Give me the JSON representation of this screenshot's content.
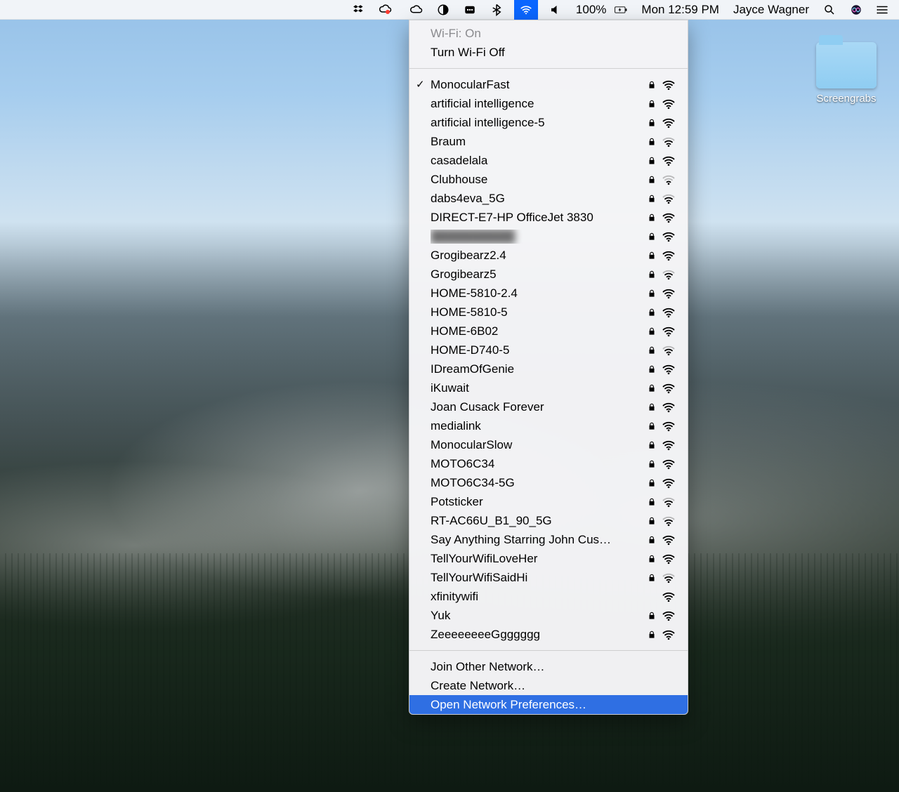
{
  "menubar": {
    "battery_text": "100%",
    "datetime": "Mon 12:59 PM",
    "username": "Jayce Wagner"
  },
  "desktop": {
    "folder_label": "Screengrabs"
  },
  "wifi_menu": {
    "status_label": "Wi-Fi: On",
    "toggle_label": "Turn Wi-Fi Off",
    "join_other_label": "Join Other Network…",
    "create_label": "Create Network…",
    "open_prefs_label": "Open Network Preferences…",
    "networks": [
      {
        "name": "MonocularFast",
        "locked": true,
        "signal": "full",
        "checked": true,
        "blurred": false
      },
      {
        "name": "artificial intelligence",
        "locked": true,
        "signal": "full",
        "checked": false,
        "blurred": false
      },
      {
        "name": "artificial intelligence-5",
        "locked": true,
        "signal": "full",
        "checked": false,
        "blurred": false
      },
      {
        "name": "Braum",
        "locked": true,
        "signal": "mid",
        "checked": false,
        "blurred": false
      },
      {
        "name": "casadelala",
        "locked": true,
        "signal": "full",
        "checked": false,
        "blurred": false
      },
      {
        "name": "Clubhouse",
        "locked": true,
        "signal": "low",
        "checked": false,
        "blurred": false
      },
      {
        "name": "dabs4eva_5G",
        "locked": true,
        "signal": "mid",
        "checked": false,
        "blurred": false
      },
      {
        "name": "DIRECT-E7-HP OfficeJet 3830",
        "locked": true,
        "signal": "full",
        "checked": false,
        "blurred": false
      },
      {
        "name": "██████████",
        "locked": true,
        "signal": "full",
        "checked": false,
        "blurred": true
      },
      {
        "name": "Grogibearz2.4",
        "locked": true,
        "signal": "full",
        "checked": false,
        "blurred": false
      },
      {
        "name": "Grogibearz5",
        "locked": true,
        "signal": "mid",
        "checked": false,
        "blurred": false
      },
      {
        "name": "HOME-5810-2.4",
        "locked": true,
        "signal": "full",
        "checked": false,
        "blurred": false
      },
      {
        "name": "HOME-5810-5",
        "locked": true,
        "signal": "full",
        "checked": false,
        "blurred": false
      },
      {
        "name": "HOME-6B02",
        "locked": true,
        "signal": "full",
        "checked": false,
        "blurred": false
      },
      {
        "name": "HOME-D740-5",
        "locked": true,
        "signal": "mid",
        "checked": false,
        "blurred": false
      },
      {
        "name": "IDreamOfGenie",
        "locked": true,
        "signal": "full",
        "checked": false,
        "blurred": false
      },
      {
        "name": "iKuwait",
        "locked": true,
        "signal": "full",
        "checked": false,
        "blurred": false
      },
      {
        "name": "Joan Cusack Forever",
        "locked": true,
        "signal": "full",
        "checked": false,
        "blurred": false
      },
      {
        "name": "medialink",
        "locked": true,
        "signal": "full",
        "checked": false,
        "blurred": false
      },
      {
        "name": "MonocularSlow",
        "locked": true,
        "signal": "full",
        "checked": false,
        "blurred": false
      },
      {
        "name": "MOTO6C34",
        "locked": true,
        "signal": "full",
        "checked": false,
        "blurred": false
      },
      {
        "name": "MOTO6C34-5G",
        "locked": true,
        "signal": "full",
        "checked": false,
        "blurred": false
      },
      {
        "name": "Potsticker",
        "locked": true,
        "signal": "mid",
        "checked": false,
        "blurred": false
      },
      {
        "name": "RT-AC66U_B1_90_5G",
        "locked": true,
        "signal": "mid",
        "checked": false,
        "blurred": false
      },
      {
        "name": "Say Anything Starring John Cus…",
        "locked": true,
        "signal": "full",
        "checked": false,
        "blurred": false
      },
      {
        "name": "TellYourWifiLoveHer",
        "locked": true,
        "signal": "full",
        "checked": false,
        "blurred": false
      },
      {
        "name": "TellYourWifiSaidHi",
        "locked": true,
        "signal": "mid",
        "checked": false,
        "blurred": false
      },
      {
        "name": "xfinitywifi",
        "locked": false,
        "signal": "full",
        "checked": false,
        "blurred": false
      },
      {
        "name": "Yuk",
        "locked": true,
        "signal": "full",
        "checked": false,
        "blurred": false
      },
      {
        "name": "ZeeeeeeeeGgggggg",
        "locked": true,
        "signal": "full",
        "checked": false,
        "blurred": false
      }
    ]
  }
}
